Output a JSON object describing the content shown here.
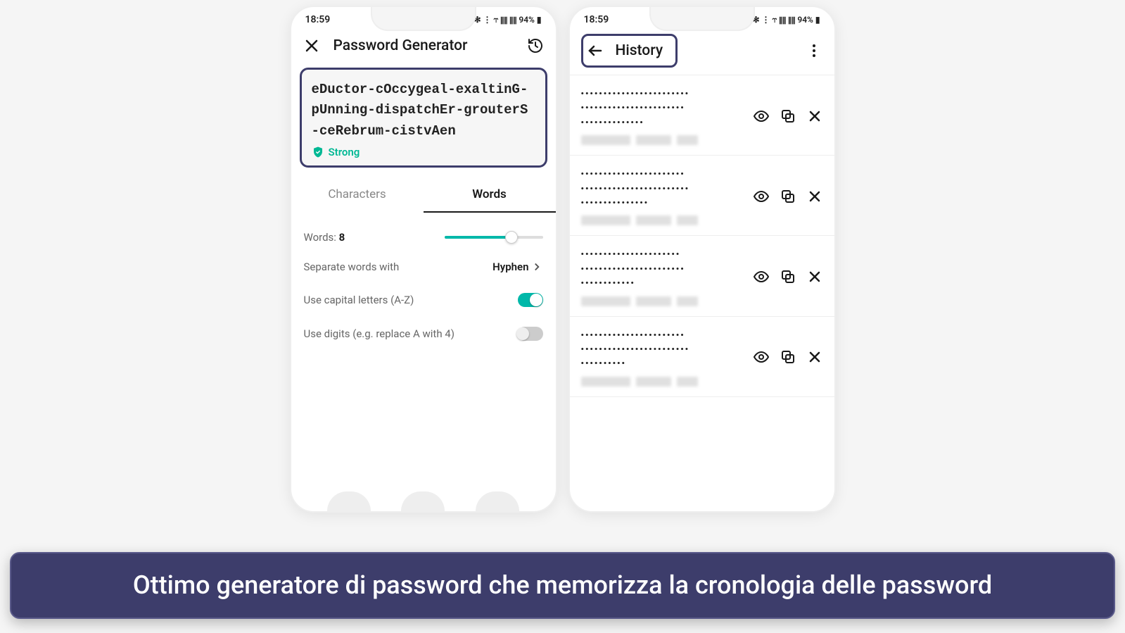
{
  "status": {
    "time": "18:59",
    "icons": "✻ ⋮ ⥾ ⫴⫴ ⫴⫴ 94% ▮"
  },
  "generator": {
    "title": "Password Generator",
    "password": "eDuctor-cOccygeal-exaltinG-pUnning-dispatchEr-grouterS-ceRebrum-cistvAen",
    "strength": "Strong",
    "tabs": {
      "characters": "Characters",
      "words": "Words"
    },
    "words_label": "Words:",
    "words_value": "8",
    "separate_label": "Separate words with",
    "separate_value": "Hyphen",
    "capital_label": "Use capital letters (A-Z)",
    "capital_on": true,
    "digits_label": "Use digits (e.g. replace A with 4)",
    "digits_on": false
  },
  "history": {
    "title": "History",
    "items": [
      {
        "lines": [
          "••••••••••••••••••••••••",
          "•••••••••••••••••••••••",
          "••••••••••••••"
        ]
      },
      {
        "lines": [
          "•••••••••••••••••••••••",
          "••••••••••••••••••••••••",
          "•••••••••••••••"
        ]
      },
      {
        "lines": [
          "••••••••••••••••••••••",
          "•••••••••••••••••••••••",
          "••••••••••••"
        ]
      },
      {
        "lines": [
          "•••••••••••••••••••••••",
          "••••••••••••••••••••••••",
          "••••••••••"
        ]
      }
    ]
  },
  "caption": "Ottimo generatore di password che memorizza la cronologia delle password"
}
